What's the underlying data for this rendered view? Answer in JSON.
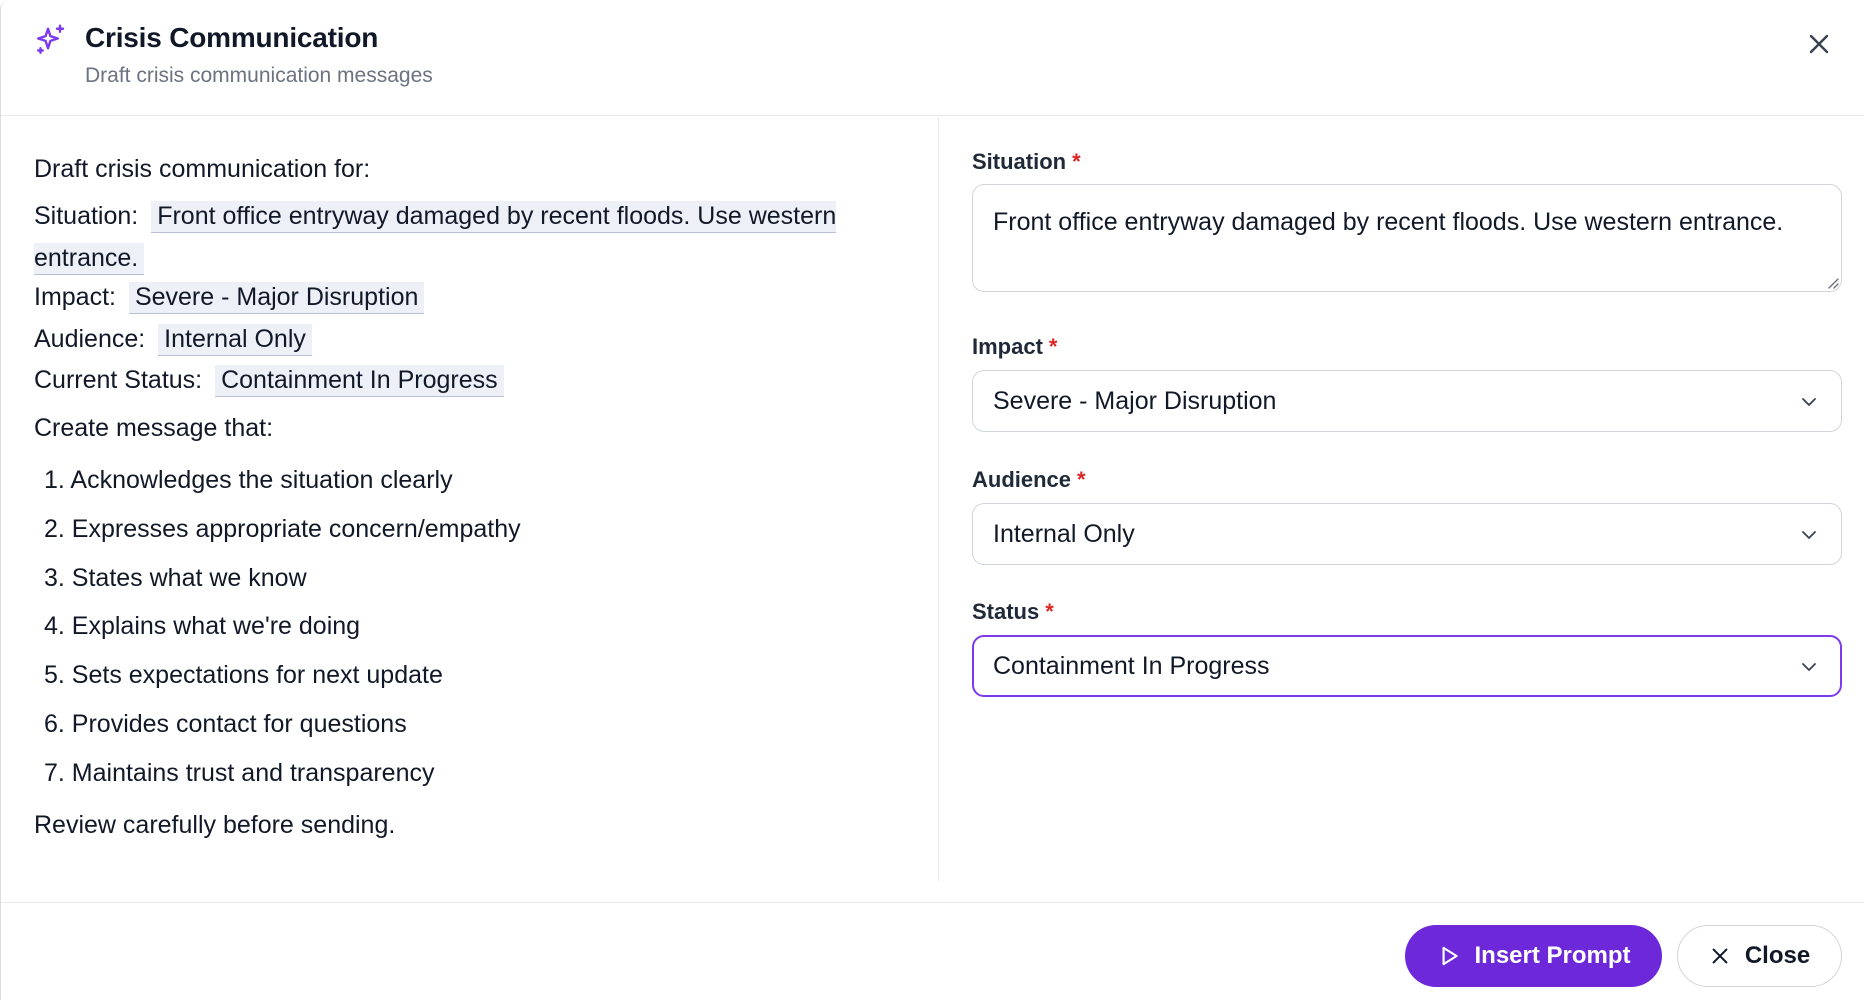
{
  "header": {
    "title": "Crisis Communication",
    "subtitle": "Draft crisis communication messages",
    "icon": "sparkles-icon",
    "accent_color": "#7c3aed"
  },
  "preview": {
    "intro": "Draft crisis communication for:",
    "situation_label": "Situation:",
    "situation_value": "Front office entryway damaged by recent floods. Use western entrance.",
    "impact_label": "Impact:",
    "impact_value": "Severe - Major Disruption",
    "audience_label": "Audience:",
    "audience_value": "Internal Only",
    "status_label": "Current Status:",
    "status_value": "Containment In Progress",
    "create_intro": "Create message that:",
    "steps": [
      "1. Acknowledges the situation clearly",
      "2. Expresses appropriate concern/empathy",
      "3. States what we know",
      "4. Explains what we're doing",
      "5. Sets expectations for next update",
      "6. Provides contact for questions",
      "7. Maintains trust and transparency"
    ],
    "outro": "Review carefully before sending."
  },
  "form": {
    "situation": {
      "label": "Situation",
      "required_mark": "*",
      "value": "Front office entryway damaged by recent floods.  Use western entrance."
    },
    "impact": {
      "label": "Impact",
      "required_mark": "*",
      "selected": "Severe - Major Disruption"
    },
    "audience": {
      "label": "Audience",
      "required_mark": "*",
      "selected": "Internal Only"
    },
    "status": {
      "label": "Status",
      "required_mark": "*",
      "selected": "Containment In Progress"
    }
  },
  "footer": {
    "insert_label": "Insert Prompt",
    "close_label": "Close",
    "primary_color": "#6d28d9"
  }
}
